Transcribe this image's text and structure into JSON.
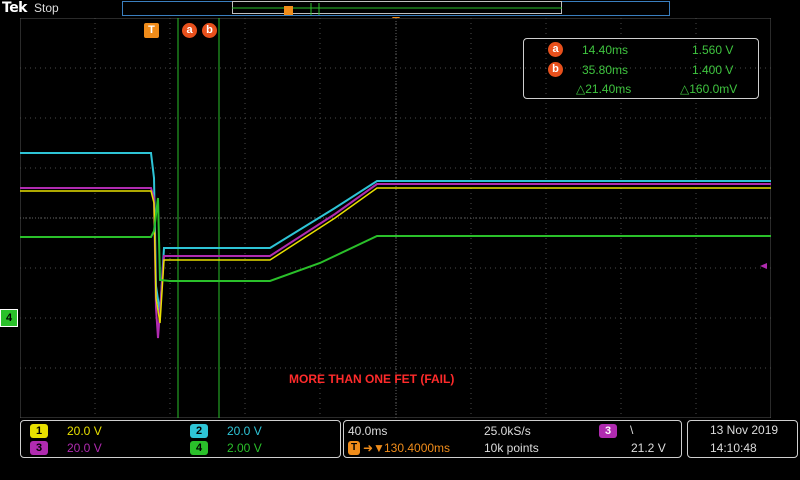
{
  "header": {
    "brand": "Tek",
    "status": "Stop",
    "trigger_marker": "T"
  },
  "cursor_labels": {
    "a": "a",
    "b": "b",
    "t": "T"
  },
  "cursor_readout": {
    "a_label": "a",
    "a_time": "14.40ms",
    "a_volt": "1.560 V",
    "b_label": "b",
    "b_time": "35.80ms",
    "b_volt": "1.400 V",
    "delta_time": "△21.40ms",
    "delta_volt": "△160.0mV"
  },
  "annotation": "MORE THAN ONE FET (FAIL)",
  "ground_marker": "4",
  "channels": {
    "ch1": {
      "num": "1",
      "scale": "20.0 V",
      "color": "#e8e000"
    },
    "ch2": {
      "num": "2",
      "scale": "20.0 V",
      "color": "#2ec4d6"
    },
    "ch3": {
      "num": "3",
      "scale": "20.0 V",
      "color": "#b02bb0"
    },
    "ch4": {
      "num": "4",
      "scale": "2.00 V",
      "color": "#2ac02a"
    }
  },
  "timebase": {
    "scale": "40.0ms",
    "sample_rate": "25.0kS/s",
    "delay": "130.4000ms",
    "record_length": "10k points"
  },
  "trigger": {
    "source": "3",
    "slope": "\\",
    "level": "21.2 V"
  },
  "datetime": {
    "date": "13 Nov 2019",
    "time": "14:10:48"
  }
}
